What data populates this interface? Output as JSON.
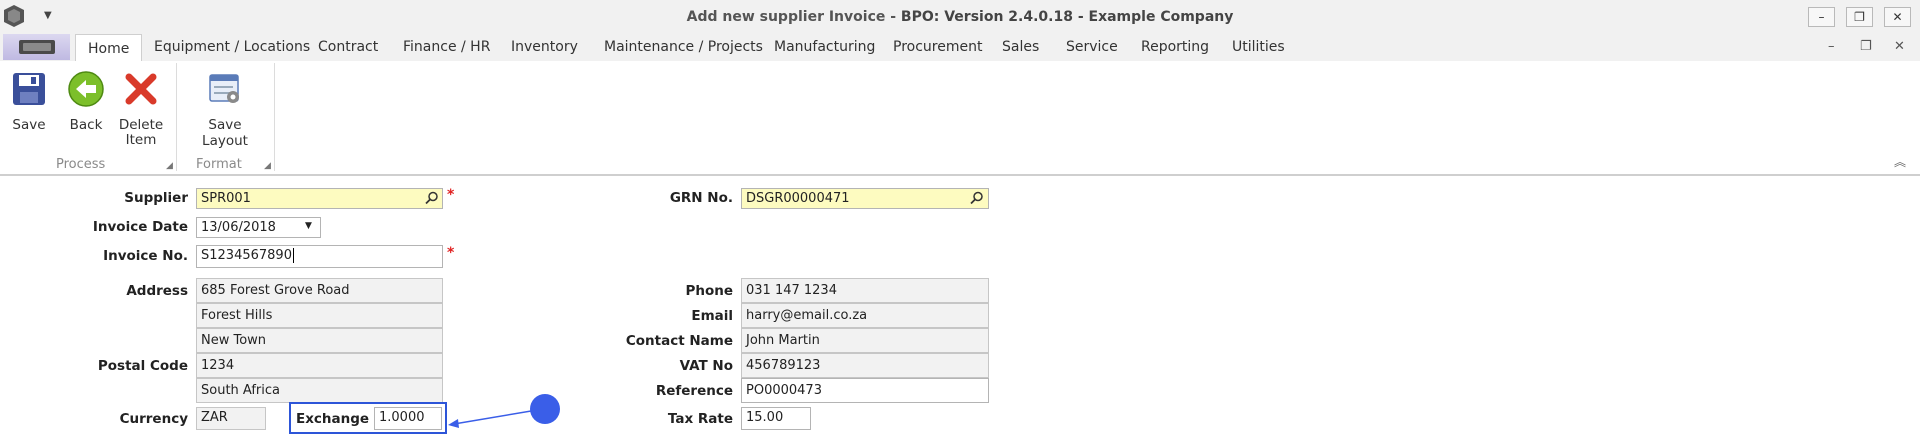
{
  "window": {
    "title_prefix": "Add new supplier Invoice - ",
    "title_bold": "BPO: Version 2.4.0.18 - Example Company",
    "min": "–",
    "restore": "❐",
    "close": "✕"
  },
  "ribbon": {
    "tabs": [
      "Home",
      "Equipment / Locations",
      "Contract",
      "Finance / HR",
      "Inventory",
      "Maintenance / Projects",
      "Manufacturing",
      "Procurement",
      "Sales",
      "Service",
      "Reporting",
      "Utilities"
    ],
    "buttons": {
      "save": "Save",
      "back": "Back",
      "delete_line1": "Delete",
      "delete_line2": "Item",
      "save_layout": "Save Layout"
    },
    "groups": {
      "process": "Process",
      "format": "Format"
    }
  },
  "form": {
    "supplier": {
      "label": "Supplier",
      "value": "SPR001"
    },
    "invoice_date": {
      "label": "Invoice Date",
      "value": "13/06/2018"
    },
    "invoice_no": {
      "label": "Invoice No.",
      "value": "S1234567890"
    },
    "address": {
      "label": "Address",
      "lines": [
        "685 Forest Grove Road",
        "Forest Hills",
        "New Town"
      ]
    },
    "postal_code": {
      "label": "Postal Code",
      "value": "1234"
    },
    "country": {
      "value": "South Africa"
    },
    "currency": {
      "label": "Currency",
      "value": "ZAR"
    },
    "exchange": {
      "label": "Exchange",
      "value": "1.0000"
    },
    "grn_no": {
      "label": "GRN No.",
      "value": "DSGR00000471"
    },
    "phone": {
      "label": "Phone",
      "value": "031 147 1234"
    },
    "email": {
      "label": "Email",
      "value": "harry@email.co.za"
    },
    "contact_name": {
      "label": "Contact Name",
      "value": "John Martin"
    },
    "vat_no": {
      "label": "VAT No",
      "value": "456789123"
    },
    "reference": {
      "label": "Reference",
      "value": "PO0000473"
    },
    "tax_rate": {
      "label": "Tax Rate",
      "value": "15.00"
    },
    "required_mark": "*"
  }
}
